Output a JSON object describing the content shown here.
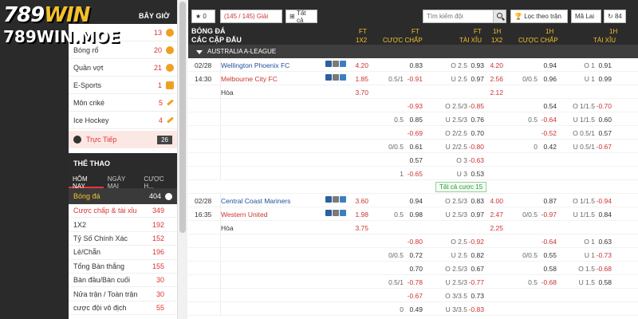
{
  "logo": {
    "line1_a": "789",
    "line1_b": "WIN",
    "line2": "789WIN.MOE"
  },
  "sidebar": {
    "top_label": "BÂY GIỜ",
    "sports": [
      {
        "label": "Bóng rổ",
        "count": "20"
      },
      {
        "label": "Quần vợt",
        "count": "21"
      },
      {
        "label": "E-Sports",
        "count": "1"
      },
      {
        "label": "Môn criké",
        "count": "5"
      },
      {
        "label": "Ice Hockey",
        "count": "4"
      }
    ],
    "first_count": "13",
    "live": {
      "label": "Trực Tiếp",
      "count": "26"
    },
    "section_title": "THỂ THAO",
    "tabs": [
      "HÔM NAY",
      "NGÀY MAI",
      "CƯỢC H..."
    ],
    "football": {
      "label": "Bóng đá",
      "count": "404"
    },
    "markets": [
      {
        "label": "Cược chấp & tài xỉu",
        "count": "349"
      },
      {
        "label": "1X2",
        "count": "192"
      },
      {
        "label": "Tỷ Số Chính Xác",
        "count": "152"
      },
      {
        "label": "Lẻ/Chẵn",
        "count": "196"
      },
      {
        "label": "Tổng Bàn thắng",
        "count": "155"
      },
      {
        "label": "Bàn đầu/Bàn cuối",
        "count": "30"
      },
      {
        "label": "Nửa trận / Toàn trận",
        "count": "30"
      },
      {
        "label": "cược đội vô địch",
        "count": "55"
      }
    ]
  },
  "toolbar": {
    "fav_count": "0",
    "games_label": "(145 / 145) Giải",
    "all_label": "Tất cả",
    "search_placeholder": "Tìm kiếm đội",
    "filter_label": "Lọc theo trận",
    "refresh_label": "Mã Lai",
    "odds_label": "84"
  },
  "columns": {
    "sport": "BÓNG ĐÁ",
    "league": "CÁC CẶP ĐẤU",
    "ft": "FT",
    "x12": "1X2",
    "handicap": "CƯỢC CHẤP",
    "ou": "TÀI XỈU",
    "h1": "1H"
  },
  "league_name": "AUSTRALIA A-LEAGUE",
  "more_label": "Tất cả cược 15",
  "matches": [
    {
      "date": "02/28",
      "time": "14:30",
      "home": "Wellington Phoenix FC",
      "away": "Melbourne City FC",
      "draw": "Hòa",
      "rows": [
        {
          "x12": "4.20",
          "hdp_line": "",
          "hdp": "0.83",
          "ou_line": "O 2.5",
          "ou": "0.93",
          "h_x12": "4.20",
          "h_line": "",
          "h_hdp": "0.94",
          "h_ou_line": "O 1",
          "h_ou": "0.91"
        },
        {
          "x12": "1.85",
          "hdp_line": "0.5/1",
          "hdp": "-0.91",
          "ou_line": "U 2.5",
          "ou": "0.97",
          "h_x12": "2.56",
          "h_line": "0/0.5",
          "h_hdp": "0.96",
          "h_ou_line": "U 1",
          "h_ou": "0.99"
        },
        {
          "x12": "3.70",
          "hdp_line": "",
          "hdp": "",
          "ou_line": "",
          "ou": "",
          "h_x12": "2.12",
          "h_line": "",
          "h_hdp": "",
          "h_ou_line": "",
          "h_ou": ""
        },
        {
          "x12": "",
          "hdp_line": "",
          "hdp": "-0.93",
          "ou_line": "O 2.5/3",
          "ou": "-0.85",
          "h_x12": "",
          "h_line": "",
          "h_hdp": "0.54",
          "h_ou_line": "O 1/1.5",
          "h_ou": "-0.70"
        },
        {
          "x12": "",
          "hdp_line": "0.5",
          "hdp": "0.85",
          "ou_line": "U 2.5/3",
          "ou": "0.76",
          "h_x12": "",
          "h_line": "0.5",
          "h_hdp": "-0.64",
          "h_ou_line": "U 1/1.5",
          "h_ou": "0.60"
        },
        {
          "x12": "",
          "hdp_line": "",
          "hdp": "-0.69",
          "ou_line": "O 2/2.5",
          "ou": "0.70",
          "h_x12": "",
          "h_line": "",
          "h_hdp": "-0.52",
          "h_ou_line": "O 0.5/1",
          "h_ou": "0.57"
        },
        {
          "x12": "",
          "hdp_line": "0/0.5",
          "hdp": "0.61",
          "ou_line": "U 2/2.5",
          "ou": "-0.80",
          "h_x12": "",
          "h_line": "0",
          "h_hdp": "0.42",
          "h_ou_line": "U 0.5/1",
          "h_ou": "-0.67"
        },
        {
          "x12": "",
          "hdp_line": "",
          "hdp": "0.57",
          "ou_line": "O 3",
          "ou": "-0.63",
          "h_x12": "",
          "h_line": "",
          "h_hdp": "",
          "h_ou_line": "",
          "h_ou": ""
        },
        {
          "x12": "",
          "hdp_line": "1",
          "hdp": "-0.65",
          "ou_line": "U 3",
          "ou": "0.53",
          "h_x12": "",
          "h_line": "",
          "h_hdp": "",
          "h_ou_line": "",
          "h_ou": ""
        }
      ]
    },
    {
      "date": "02/28",
      "time": "16:35",
      "home": "Central Coast Mariners",
      "away": "Western United",
      "draw": "Hòa",
      "rows": [
        {
          "x12": "3.60",
          "hdp_line": "",
          "hdp": "0.94",
          "ou_line": "O 2.5/3",
          "ou": "0.83",
          "h_x12": "4.00",
          "h_line": "",
          "h_hdp": "0.87",
          "h_ou_line": "O 1/1.5",
          "h_ou": "-0.94"
        },
        {
          "x12": "1.98",
          "hdp_line": "0.5",
          "hdp": "0.98",
          "ou_line": "U 2.5/3",
          "ou": "0.97",
          "h_x12": "2.47",
          "h_line": "0/0.5",
          "h_hdp": "-0.97",
          "h_ou_line": "U 1/1.5",
          "h_ou": "0.84"
        },
        {
          "x12": "3.75",
          "hdp_line": "",
          "hdp": "",
          "ou_line": "",
          "ou": "",
          "h_x12": "2.25",
          "h_line": "",
          "h_hdp": "",
          "h_ou_line": "",
          "h_ou": ""
        },
        {
          "x12": "",
          "hdp_line": "",
          "hdp": "-0.80",
          "ou_line": "O 2.5",
          "ou": "-0.92",
          "h_x12": "",
          "h_line": "",
          "h_hdp": "-0.64",
          "h_ou_line": "O 1",
          "h_ou": "0.63"
        },
        {
          "x12": "",
          "hdp_line": "0/0.5",
          "hdp": "0.72",
          "ou_line": "U 2.5",
          "ou": "0.82",
          "h_x12": "",
          "h_line": "0/0.5",
          "h_hdp": "0.55",
          "h_ou_line": "U 1",
          "h_ou": "-0.73"
        },
        {
          "x12": "",
          "hdp_line": "",
          "hdp": "0.70",
          "ou_line": "O 2.5/3",
          "ou": "0.67",
          "h_x12": "",
          "h_line": "",
          "h_hdp": "0.58",
          "h_ou_line": "O 1.5",
          "h_ou": "-0.68"
        },
        {
          "x12": "",
          "hdp_line": "0.5/1",
          "hdp": "-0.78",
          "ou_line": "U 2.5/3",
          "ou": "-0.77",
          "h_x12": "",
          "h_line": "0.5",
          "h_hdp": "-0.68",
          "h_ou_line": "U 1.5",
          "h_ou": "0.58"
        },
        {
          "x12": "",
          "hdp_line": "",
          "hdp": "-0.67",
          "ou_line": "O 3/3.5",
          "ou": "0.73",
          "h_x12": "",
          "h_line": "",
          "h_hdp": "",
          "h_ou_line": "",
          "h_ou": ""
        },
        {
          "x12": "",
          "hdp_line": "0",
          "hdp": "0.49",
          "ou_line": "U 3/3.5",
          "ou": "-0.83",
          "h_x12": "",
          "h_line": "",
          "h_hdp": "",
          "h_ou_line": "",
          "h_ou": ""
        }
      ]
    }
  ],
  "colors": {
    "accent": "#f3c12b",
    "red": "#cc3333",
    "blue": "#1f4f9e",
    "dark": "#2b2b2b"
  }
}
